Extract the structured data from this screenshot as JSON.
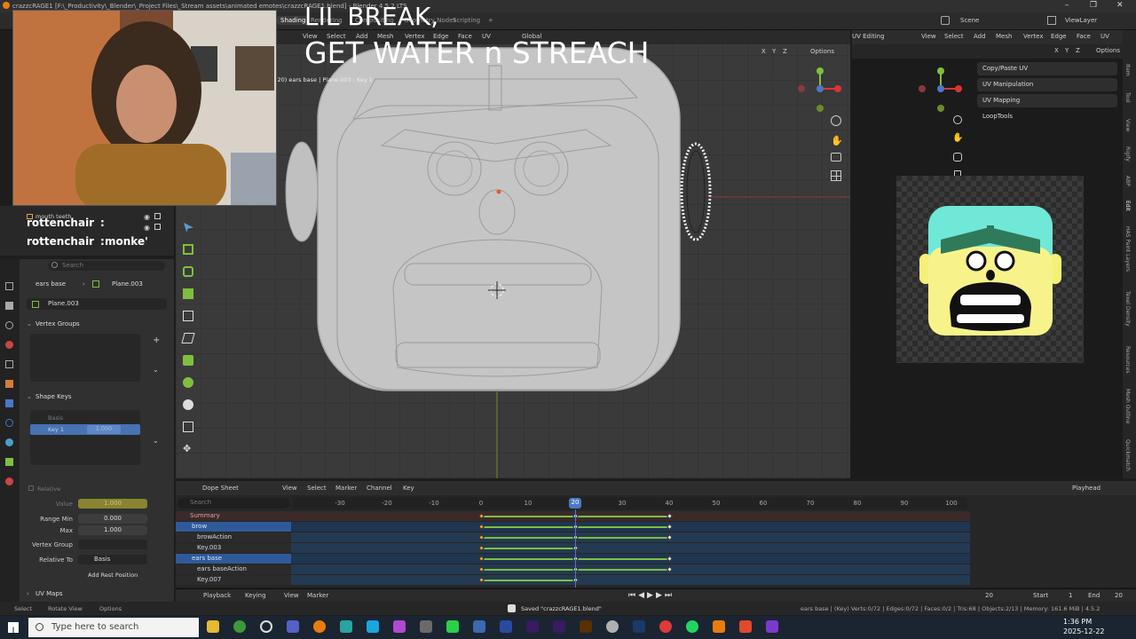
{
  "window": {
    "title": "crazzcRAGE1 [F:\\_Productivity\\_Blender\\_Project Files\\_Stream assets\\animated emotes\\crazzcRAGE1.blend] - Blender 4.5.2 LTS",
    "controls": [
      "–",
      "❐",
      "✕"
    ]
  },
  "header": {
    "tabs": [
      "Shading",
      "Rendering",
      "Compositing",
      "Geometry Nodes",
      "Scripting",
      "+"
    ],
    "active_tab": "Shading",
    "scene_label": "Scene",
    "view_layer_label": "ViewLayer"
  },
  "overlay": {
    "line1": "LIL BREAK,",
    "line2": "GET WATER n STREACH"
  },
  "viewport": {
    "menus": [
      "View",
      "Select",
      "Add",
      "Mesh",
      "Vertex",
      "Edge",
      "Face",
      "UV"
    ],
    "orientation": "Global",
    "options_label": "Options",
    "axis_x": "X",
    "axis_y": "Y",
    "axis_z": "Z",
    "object_info": "(20) ears base | Plane.003 : Key 1"
  },
  "uv_editor": {
    "mode_label": "UV Editing",
    "menus": [
      "View",
      "Select",
      "Add",
      "Mesh",
      "Vertex",
      "Edge",
      "Face",
      "UV"
    ],
    "options_label": "Options",
    "axis_x": "X",
    "axis_y": "Y",
    "axis_z": "Z",
    "panels": [
      "Copy/Paste UV",
      "UV Manipulation",
      "UV Mapping",
      "LoopTools"
    ],
    "side_tabs": [
      "Item",
      "Tool",
      "View",
      "Rigify",
      "ABP",
      "Edit",
      "HAS Paint Layers",
      "Texel Density",
      "Resources",
      "Mesh Outline",
      "Quickmatch"
    ]
  },
  "outliner": {
    "item": "mouth teeth",
    "chat": [
      {
        "user": "rottenchair",
        "msg": ""
      },
      {
        "user": "rottenchair",
        "msg": "monke'"
      }
    ]
  },
  "properties": {
    "search_placeholder": "Search",
    "breadcrumb_object": "ears base",
    "breadcrumb_mesh": "Plane.003",
    "mesh_name": "Plane.003",
    "vertex_groups_label": "Vertex Groups",
    "shape_keys_label": "Shape Keys",
    "shape_keys": [
      {
        "name": "Basis",
        "value": ""
      },
      {
        "name": "Key 1",
        "value": "1.000"
      }
    ],
    "relative_label": "Relative",
    "value_label": "Value",
    "value": "1.000",
    "range_min_label": "Range Min",
    "range_min": "0.000",
    "max_label": "Max",
    "max": "1.000",
    "vertex_group_label": "Vertex Group",
    "relative_to_label": "Relative To",
    "relative_to": "Basis",
    "add_rest_position": "Add Rest Position",
    "uv_maps_label": "UV Maps"
  },
  "dopesheet": {
    "mode": "Dope Sheet",
    "menus": [
      "View",
      "Select",
      "Marker",
      "Channel",
      "Key"
    ],
    "search_placeholder": "Search",
    "playhead_label": "Playhead",
    "ticks": [
      "-30",
      "-20",
      "-10",
      "0",
      "10",
      "20",
      "30",
      "40",
      "50",
      "60",
      "70",
      "80",
      "90",
      "100"
    ],
    "current_frame": "20",
    "channels": [
      {
        "name": "Summary",
        "kind": "summary"
      },
      {
        "name": "brow",
        "kind": "object"
      },
      {
        "name": "browAction",
        "kind": "action"
      },
      {
        "name": "Key.003",
        "kind": "key"
      },
      {
        "name": "ears base",
        "kind": "object"
      },
      {
        "name": "ears baseAction",
        "kind": "action"
      },
      {
        "name": "Key.007",
        "kind": "key"
      }
    ],
    "keyframes": [
      {
        "channel": 0,
        "frames": [
          0,
          20,
          40
        ]
      },
      {
        "channel": 1,
        "frames": [
          0,
          20,
          40
        ]
      },
      {
        "channel": 2,
        "frames": [
          0,
          20,
          40
        ]
      },
      {
        "channel": 3,
        "frames": [
          0,
          20
        ]
      },
      {
        "channel": 4,
        "frames": [
          0,
          20,
          40
        ]
      },
      {
        "channel": 5,
        "frames": [
          0,
          20,
          40
        ]
      },
      {
        "channel": 6,
        "frames": [
          0,
          20
        ]
      }
    ]
  },
  "timeline": {
    "menus": [
      "Playback",
      "Keying",
      "View",
      "Marker"
    ],
    "frame": "20",
    "start_label": "Start",
    "start": "1",
    "end_label": "End",
    "end": "20"
  },
  "statusbar": {
    "select": "Select",
    "rotate": "Rotate View",
    "options": "Options",
    "message": "Saved \"crazzcRAGE1.blend\"",
    "stats": "ears base | (Key) Verts:0/72 | Edges:0/72 | Faces:0/2 | Tris:68 | Objects:2/13 | Memory: 161.6 MiB | 4.5.2"
  },
  "taskbar": {
    "search_placeholder": "Type here to search",
    "time": "1:36 PM",
    "date": "2025-12-22"
  },
  "colors": {
    "accent": "#4772b3",
    "keyframe_selected": "#e6a23c",
    "hold_bar": "#7fbf3f",
    "playhead": "#4a78c8"
  }
}
